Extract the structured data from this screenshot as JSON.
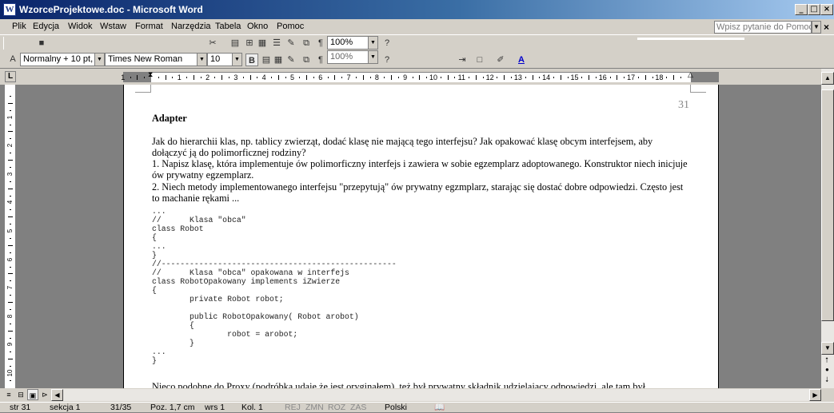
{
  "window": {
    "title": "WzorceProjektowe.doc - Microsoft Word",
    "app_icon": "word-icon",
    "minimize": "_",
    "maximize": "□",
    "close": "×"
  },
  "menu": {
    "items": [
      "Plik",
      "Edycja",
      "Widok",
      "Wstaw",
      "Format",
      "Narzędzia",
      "Tabela",
      "Okno",
      "Pomoc"
    ],
    "help_placeholder": "Wpisz pytanie do Pomocy",
    "doc_close": "×"
  },
  "toolbar": {
    "zoom": "100%",
    "zoom_ghost": "100%",
    "style": "Normalny + 10 pt,",
    "font": "Times New Roman",
    "size": "10",
    "bold": "B",
    "pilcrow": "¶"
  },
  "ruler": {
    "corner": "L",
    "numbers": [
      "1",
      "1",
      "2",
      "3",
      "4",
      "5",
      "6",
      "7",
      "8",
      "9",
      "10",
      "11",
      "12",
      "13",
      "14",
      "15",
      "16",
      "17",
      "18"
    ],
    "vnumbers": [
      "1",
      "2",
      "3",
      "4",
      "5",
      "6",
      "7",
      "8",
      "9",
      "10"
    ]
  },
  "document": {
    "page_number": "31",
    "heading": "Adapter",
    "para1": "Jak do hierarchii klas, np. tablicy zwierząt, dodać klasę nie mającą tego interfejsu? Jak opakować klasę obcym interfejsem, aby dołączyć ją do polimorficznej rodziny?",
    "para2": "1. Napisz klasę, która implementuje ów polimorficzny interfejs i zawiera w sobie egzemplarz adoptowanego. Konstruktor niech inicjuje ów prywatny egzemplarz.",
    "para3": "2. Niech metody implementowanego interfejsu \"przepytują\" ów prywatny egzmplarz, starając się dostać dobre odpowiedzi. Często jest to machanie rękami ...",
    "code": "...\n//      Klasa \"obca\"\nclass Robot\n{\n...\n}\n//--------------------------------------------------\n//      Klasa \"obca\" opakowana w interfejs\nclass RobotOpakowany implements iZwierze\n{\n        private Robot robot;\n\n        public RobotOpakowany( Robot arobot)\n        {\n                robot = arobot;\n        }\n...\n}",
    "bottom_text": "Nieco podobne do Proxy (podróbka udaje że jest oryginałem), też był prywatny składnik udzielający odpowiedzi, ale tam był"
  },
  "status": {
    "page": "str 31",
    "section": "sekcja 1",
    "pages": "31/35",
    "position": "Poz. 1,7 cm",
    "line": "wrs 1",
    "column": "Kol. 1",
    "rej": "REJ",
    "zmn": "ZMN",
    "roz": "ROZ",
    "zas": "ZAS",
    "language": "Polski"
  }
}
